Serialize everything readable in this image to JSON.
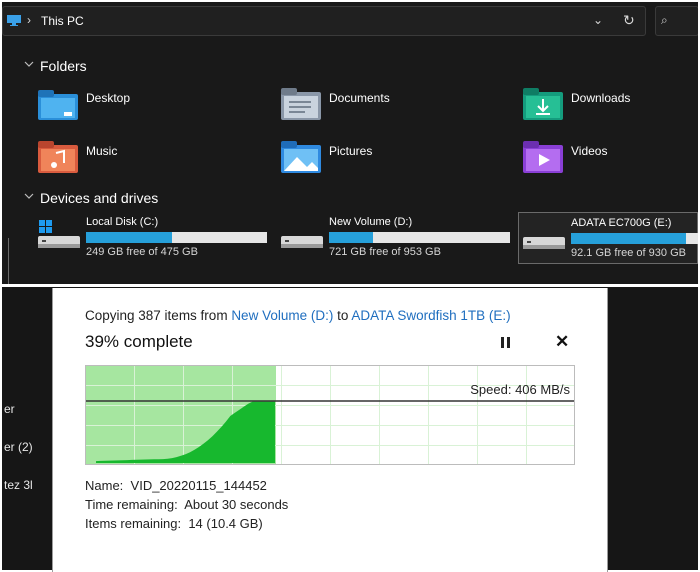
{
  "explorer": {
    "breadcrumb": "This PC",
    "folders_header": "Folders",
    "drives_header": "Devices and drives",
    "folders": [
      {
        "label": "Desktop",
        "icon": "desktop-folder-icon"
      },
      {
        "label": "Documents",
        "icon": "documents-folder-icon"
      },
      {
        "label": "Downloads",
        "icon": "downloads-folder-icon"
      },
      {
        "label": "Music",
        "icon": "music-folder-icon"
      },
      {
        "label": "Pictures",
        "icon": "pictures-folder-icon"
      },
      {
        "label": "Videos",
        "icon": "videos-folder-icon"
      }
    ],
    "drives": [
      {
        "label": "Local Disk (C:)",
        "free_text": "249 GB free of 475 GB",
        "used_fraction": 0.476
      },
      {
        "label": "New Volume (D:)",
        "free_text": "721 GB free of 953 GB",
        "used_fraction": 0.243
      },
      {
        "label": "ADATA EC700G (E:)",
        "free_text": "92.1 GB free of 930 GB",
        "used_fraction": 0.901
      }
    ]
  },
  "sidebar_fragments": [
    "er",
    "er (2)",
    "tez 3l"
  ],
  "dialog": {
    "copy_prefix": "Copying 387 items from ",
    "source": "New Volume (D:)",
    "copy_to": " to ",
    "destination": "ADATA Swordfish 1TB (E:)",
    "percent_text": "39% complete",
    "progress_fraction": 0.39,
    "speed_text": "Speed: 406 MB/s",
    "name_label": "Name:",
    "name_value": "VID_20220115_144452",
    "time_label": "Time remaining:",
    "time_value": "About 30 seconds",
    "items_label": "Items remaining:",
    "items_value": "14 (10.4 GB)"
  },
  "colors": {
    "explorer_bg": "#191919",
    "drive_bar_fill": "#26a0da",
    "progress_fill": "#a6e6a0",
    "speed_area": "#17b82e",
    "link": "#1f6ebf"
  }
}
